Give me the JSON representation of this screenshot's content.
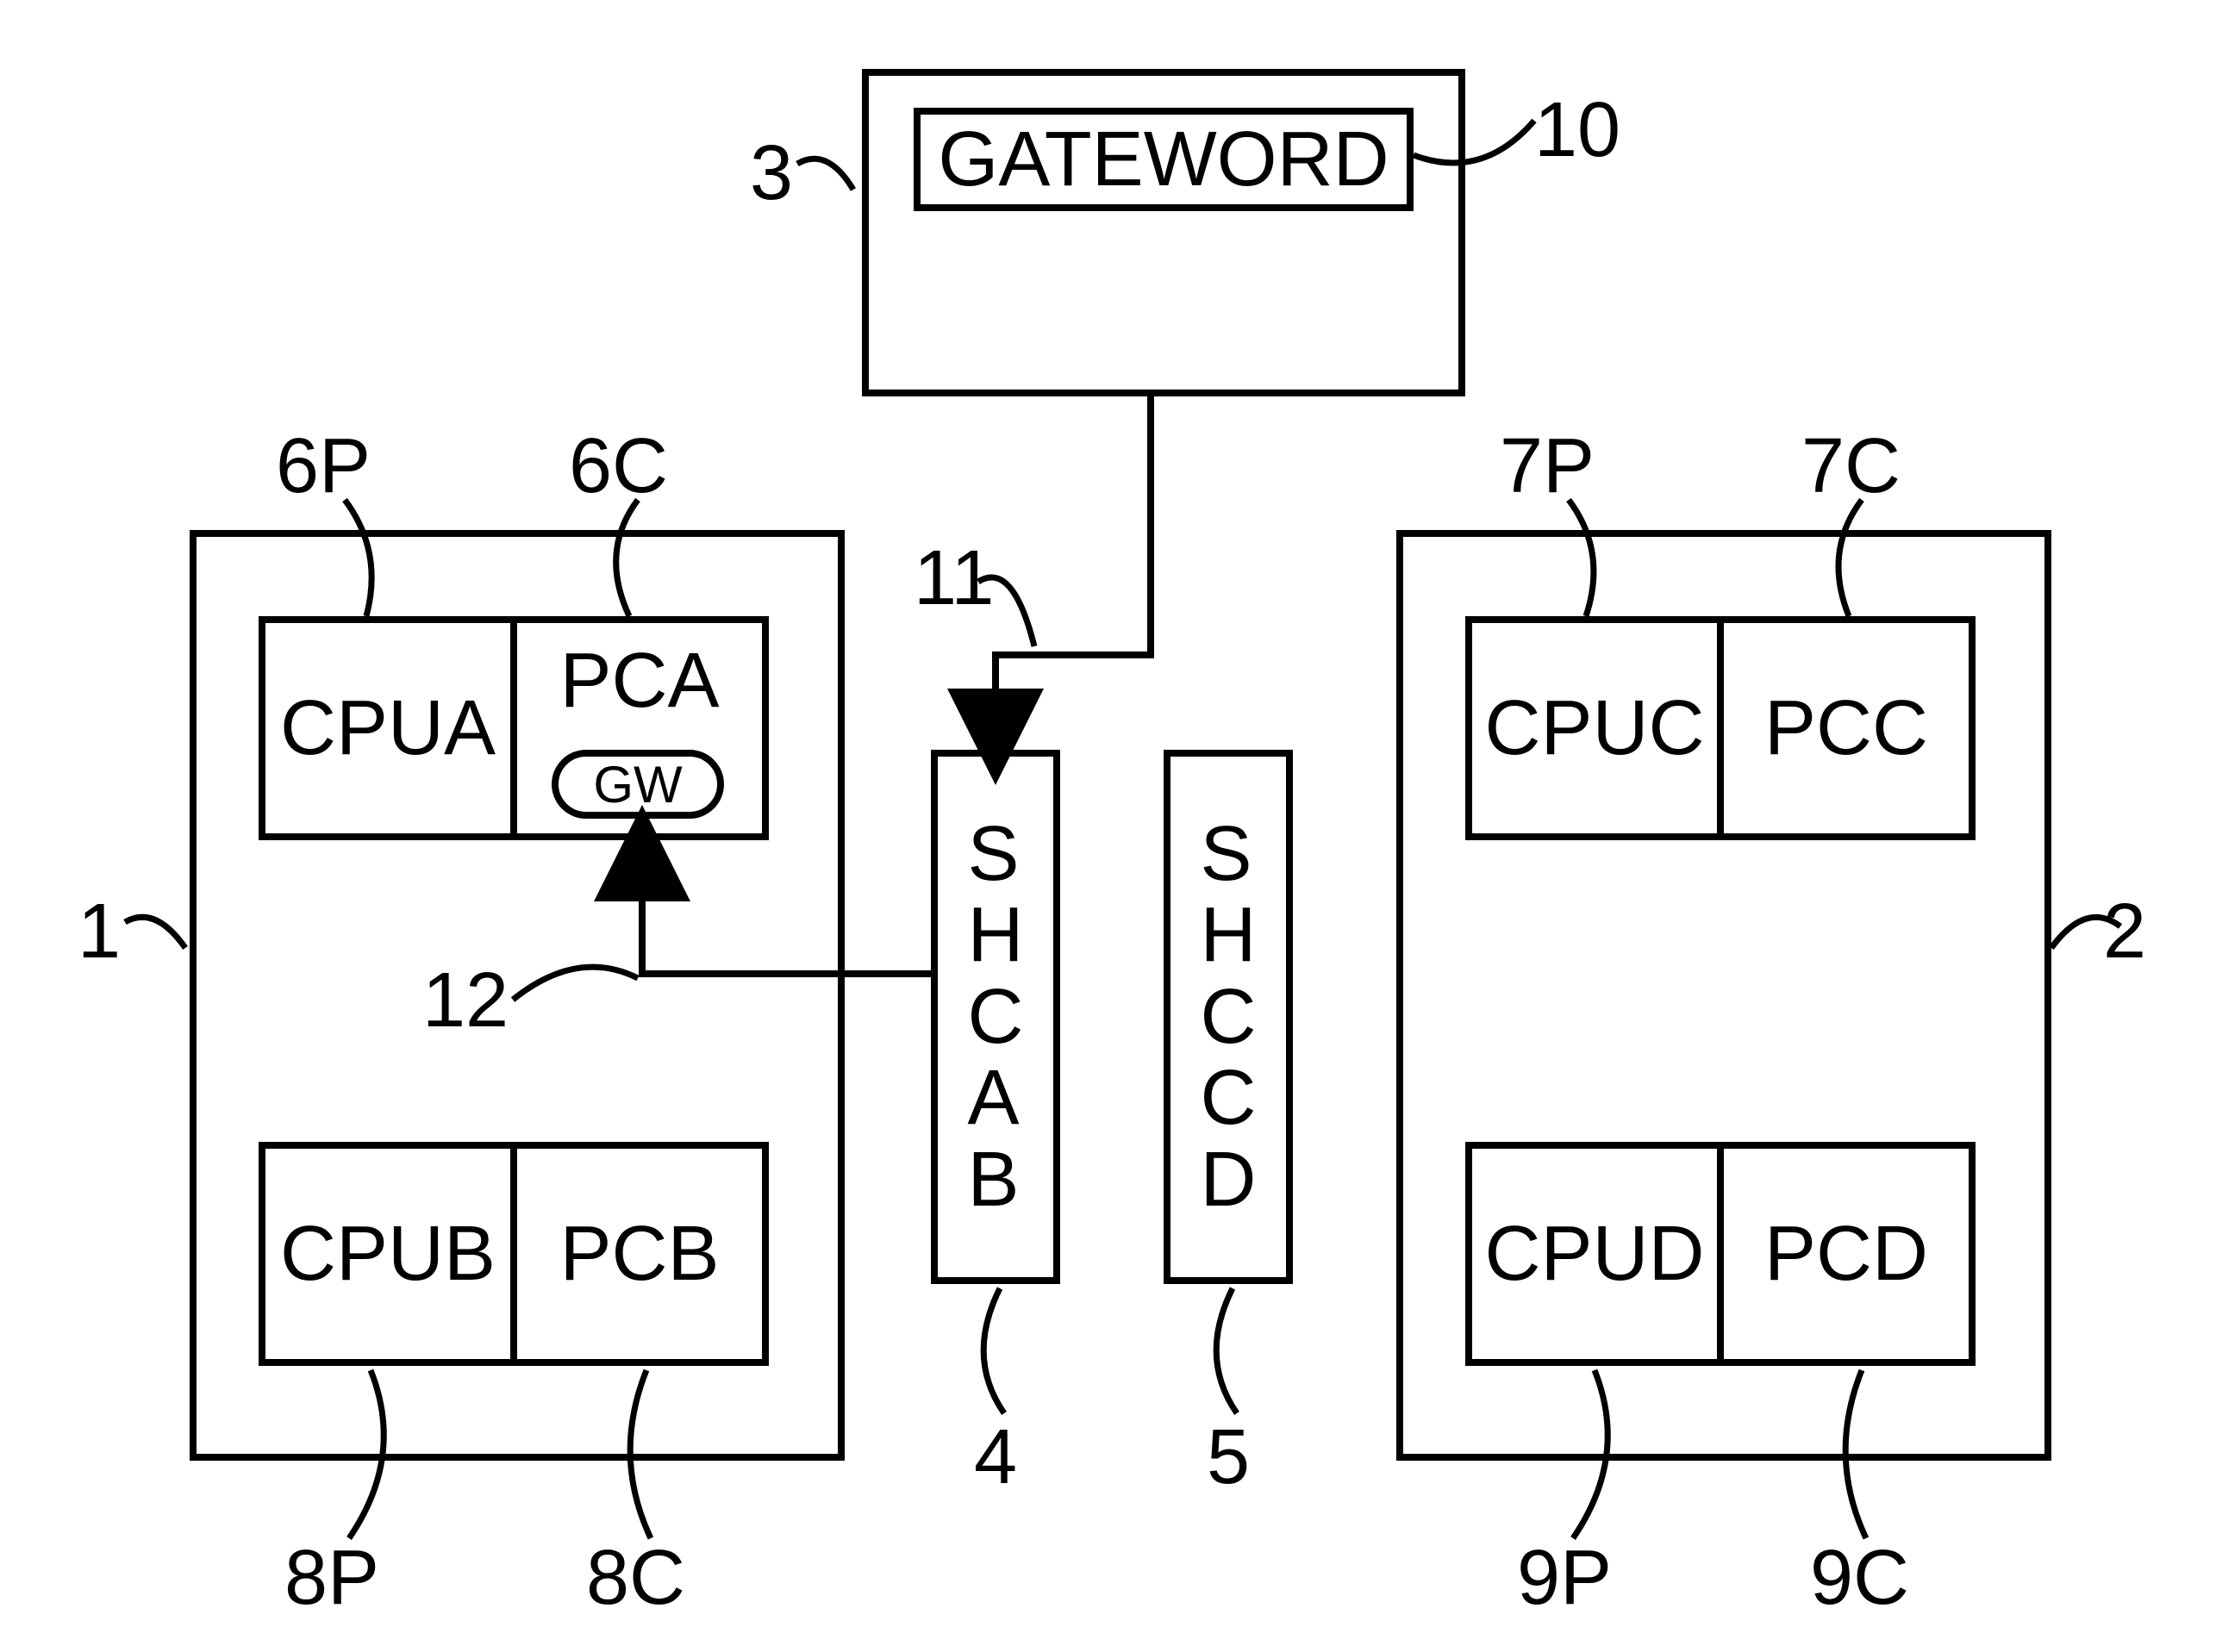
{
  "top": {
    "gateword": "GATEWORD"
  },
  "left": {
    "cpuA": "CPUA",
    "pcA": "PCA",
    "gw": "GW",
    "cpuB": "CPUB",
    "pcB": "PCB"
  },
  "mid": {
    "shcab": "S\nH\nC\nA\nB",
    "shccd": "S\nH\nC\nC\nD"
  },
  "right": {
    "cpuC": "CPUC",
    "pcC": "PCC",
    "cpuD": "CPUD",
    "pcD": "PCD"
  },
  "refs": {
    "r1": "1",
    "r2": "2",
    "r3": "3",
    "r4": "4",
    "r5": "5",
    "r6P": "6P",
    "r6C": "6C",
    "r7P": "7P",
    "r7C": "7C",
    "r8P": "8P",
    "r8C": "8C",
    "r9P": "9P",
    "r9C": "9C",
    "r10": "10",
    "r11": "11",
    "r12": "12"
  }
}
